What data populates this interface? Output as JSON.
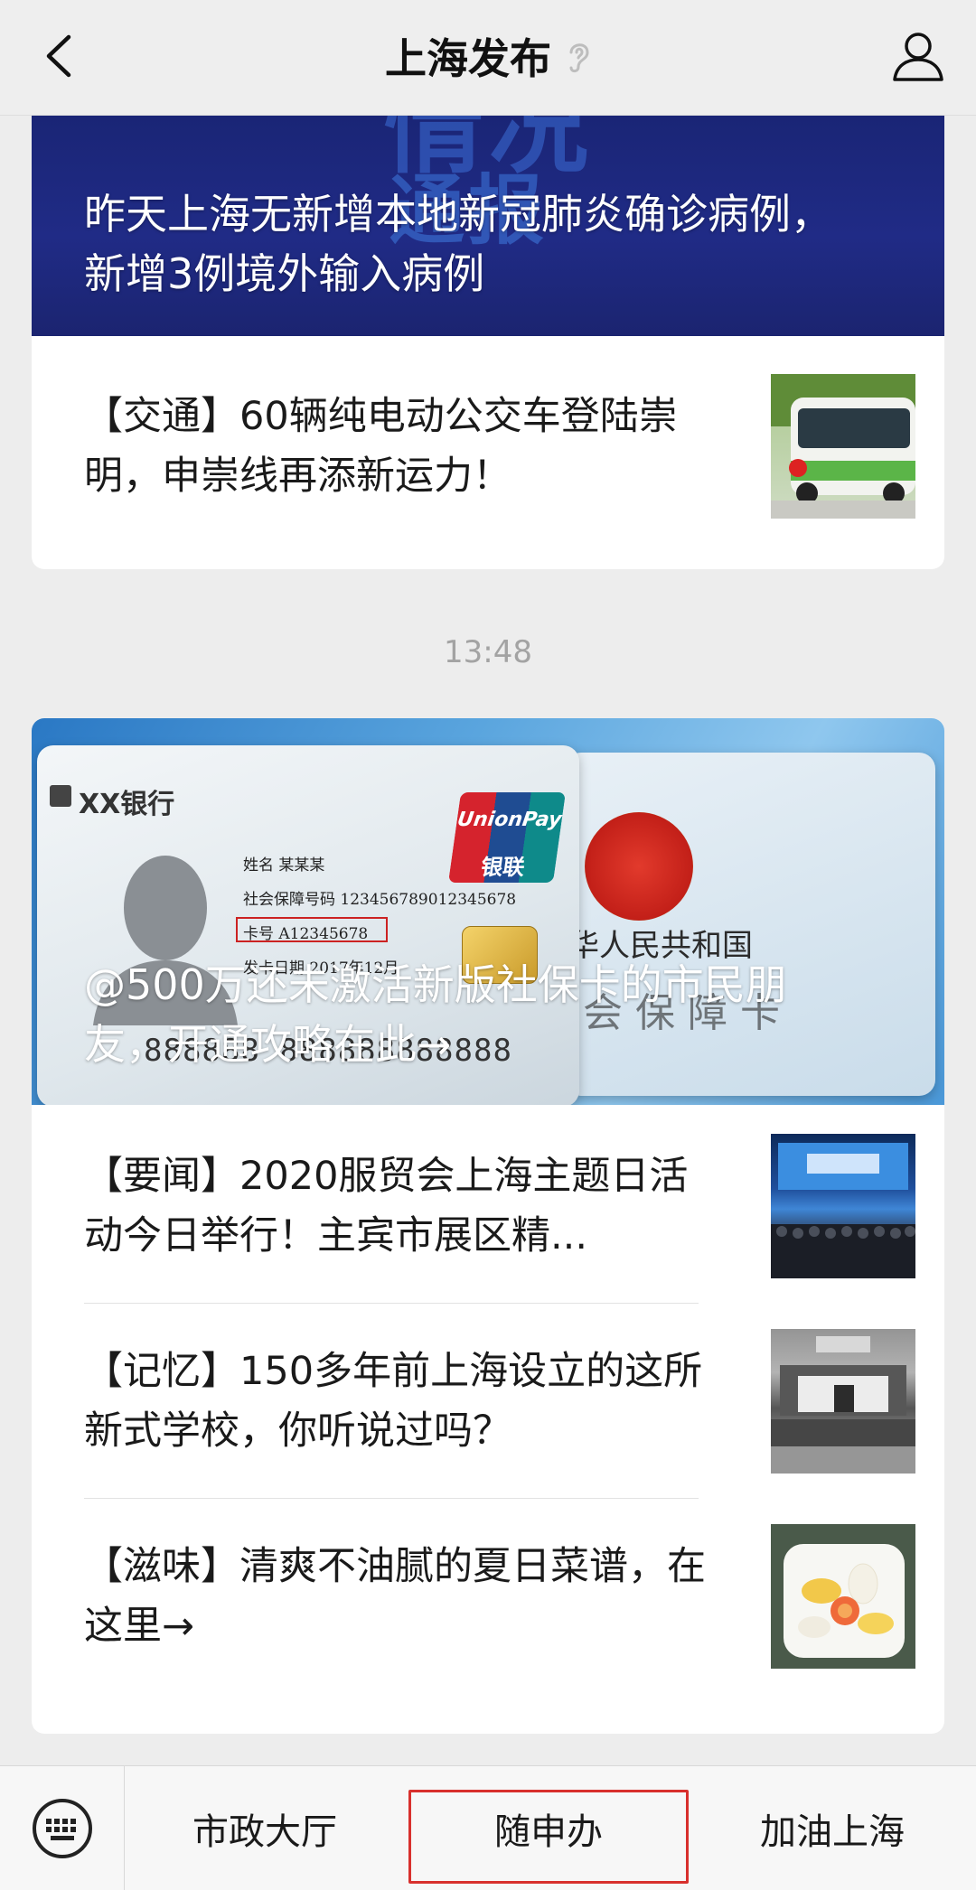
{
  "header": {
    "title": "上海发布",
    "back_icon": "chevron-left-icon",
    "status_icon": "ear-icon",
    "user_icon": "user-icon"
  },
  "card1": {
    "banner_deco": "情况",
    "banner_deco2": "通报",
    "banner_title": "昨天上海无新增本地新冠肺炎确诊病例，新增3例境外输入病例",
    "items": [
      {
        "text": "【交通】60辆纯电动公交车登陆崇明，申崇线再添新运力！",
        "thumb": "electric-bus-photo"
      }
    ]
  },
  "time_label": "13:48",
  "card2": {
    "banner_title": "@500万还未激活新版社保卡的市民朋友，开通攻略在此→",
    "banner_card": {
      "bank": "XX银行",
      "name_line": "姓名  某某某",
      "ssn_line": "社会保障号码  123456789012345678",
      "card_no_line": "卡号   A12345678",
      "issue_line": "发卡日期   2017年12月",
      "card_number": "888888 888888888888",
      "unionpay_en": "UnionPay",
      "unionpay_cn": "银联",
      "back_line1": "华人民共和国",
      "back_line2": "会 保 障 卡"
    },
    "items": [
      {
        "text": "【要闻】2020服贸会上海主题日活动今日举行！主宾市展区精...",
        "thumb": "conference-photo"
      },
      {
        "text": "【记忆】150多年前上海设立的这所新式学校，你听说过吗？",
        "thumb": "old-school-photo"
      },
      {
        "text": "【滋味】清爽不油腻的夏日菜谱，在这里→",
        "thumb": "summer-dish-photo"
      }
    ]
  },
  "bottom_menu": {
    "keyboard_icon": "keyboard-icon",
    "items": [
      "市政大厅",
      "随申办",
      "加油上海"
    ],
    "highlighted": "随申办",
    "highlight_color": "#d8302d"
  }
}
